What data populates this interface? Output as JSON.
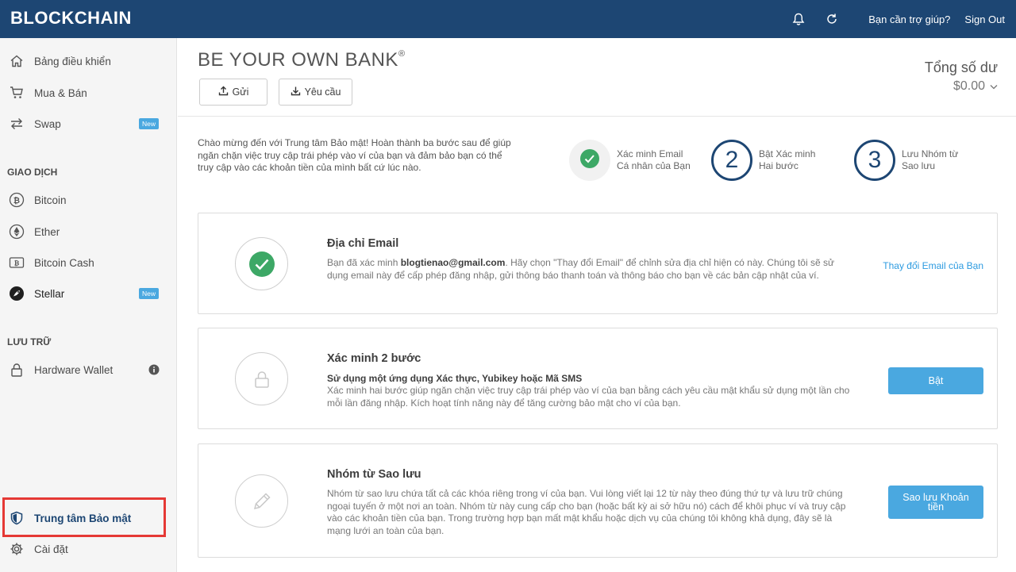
{
  "header": {
    "logo": "BLOCKCHAIN",
    "help_link": "Bạn cần trợ giúp?",
    "sign_out": "Sign Out"
  },
  "sidebar": {
    "items": [
      {
        "label": "Bảng điều khiển",
        "icon": "home-icon"
      },
      {
        "label": "Mua & Bán",
        "icon": "cart-icon"
      },
      {
        "label": "Swap",
        "icon": "swap-icon",
        "badge": "New"
      }
    ],
    "trade_title": "GIAO DỊCH",
    "trade_items": [
      {
        "label": "Bitcoin",
        "icon": "bitcoin-icon"
      },
      {
        "label": "Ether",
        "icon": "ether-icon"
      },
      {
        "label": "Bitcoin Cash",
        "icon": "bitcoin-cash-icon"
      },
      {
        "label": "Stellar",
        "icon": "stellar-icon",
        "badge": "New"
      }
    ],
    "storage_title": "LƯU TRỮ",
    "hardware_wallet": "Hardware Wallet",
    "security_center": "Trung tâm Bảo mật",
    "settings": "Cài đặt"
  },
  "main": {
    "title": "BE YOUR OWN BANK",
    "title_mark": "®",
    "send_label": "Gửi",
    "request_label": "Yêu cầu",
    "balance_label": "Tổng số dư",
    "balance_value": "$0.00",
    "intro": "Chào mừng đến với Trung tâm Bảo mật! Hoàn thành ba bước sau để giúp ngăn chặn việc truy cập trái phép vào ví của bạn và đảm bảo bạn có thể truy cập vào các khoản tiền của mình bất cứ lúc nào.",
    "steps": [
      {
        "line1": "Xác minh Email",
        "line2": "Cá nhân của Bạn",
        "status": "done"
      },
      {
        "number": "2",
        "line1": "Bật Xác minh",
        "line2": "Hai bước"
      },
      {
        "number": "3",
        "line1": "Lưu Nhóm từ",
        "line2": "Sao lưu"
      }
    ],
    "cards": {
      "email": {
        "title": "Địa chỉ Email",
        "desc_pre": "Bạn đã xác minh ",
        "email": "blogtienao@gmail.com",
        "desc_post": ". Hãy chọn \"Thay đổi Email\" để chỉnh sửa địa chỉ hiện có này. Chúng tôi sẽ sử dụng email này để cấp phép đăng nhập, gửi thông báo thanh toán và thông báo cho bạn về các bản cập nhật của ví.",
        "action": "Thay đổi Email của Bạn"
      },
      "twofa": {
        "title": "Xác minh 2 bước",
        "subtitle": "Sử dụng một ứng dụng Xác thực, Yubikey hoặc Mã SMS",
        "desc": "Xác minh hai bước giúp ngăn chặn việc truy cập trái phép vào ví của bạn bằng cách yêu cầu mật khẩu sử dụng một lần cho mỗi lần đăng nhập. Kích hoạt tính năng này để tăng cường bảo mật cho ví của bạn.",
        "action": "Bật"
      },
      "backup": {
        "title": "Nhóm từ Sao lưu",
        "desc": "Nhóm từ sao lưu chứa tất cả các khóa riêng trong ví của bạn. Vui lòng viết lại 12 từ này theo đúng thứ tự và lưu trữ chúng ngoại tuyến ở một nơi an toàn. Nhóm từ này cung cấp cho bạn (hoặc bất kỳ ai sở hữu nó) cách để khôi phục ví và truy cập vào các khoản tiền của bạn.  Trong trường hợp bạn mất mật khẩu hoặc dịch vụ của chúng tôi không khả dụng, đây sẽ là mạng lưới an toàn của bạn.",
        "action": "Sao lưu Khoản tiền"
      }
    }
  },
  "colors": {
    "header_bg": "#1d4673",
    "accent": "#4aa8e0",
    "success": "#3da866",
    "highlight": "#e53935"
  }
}
